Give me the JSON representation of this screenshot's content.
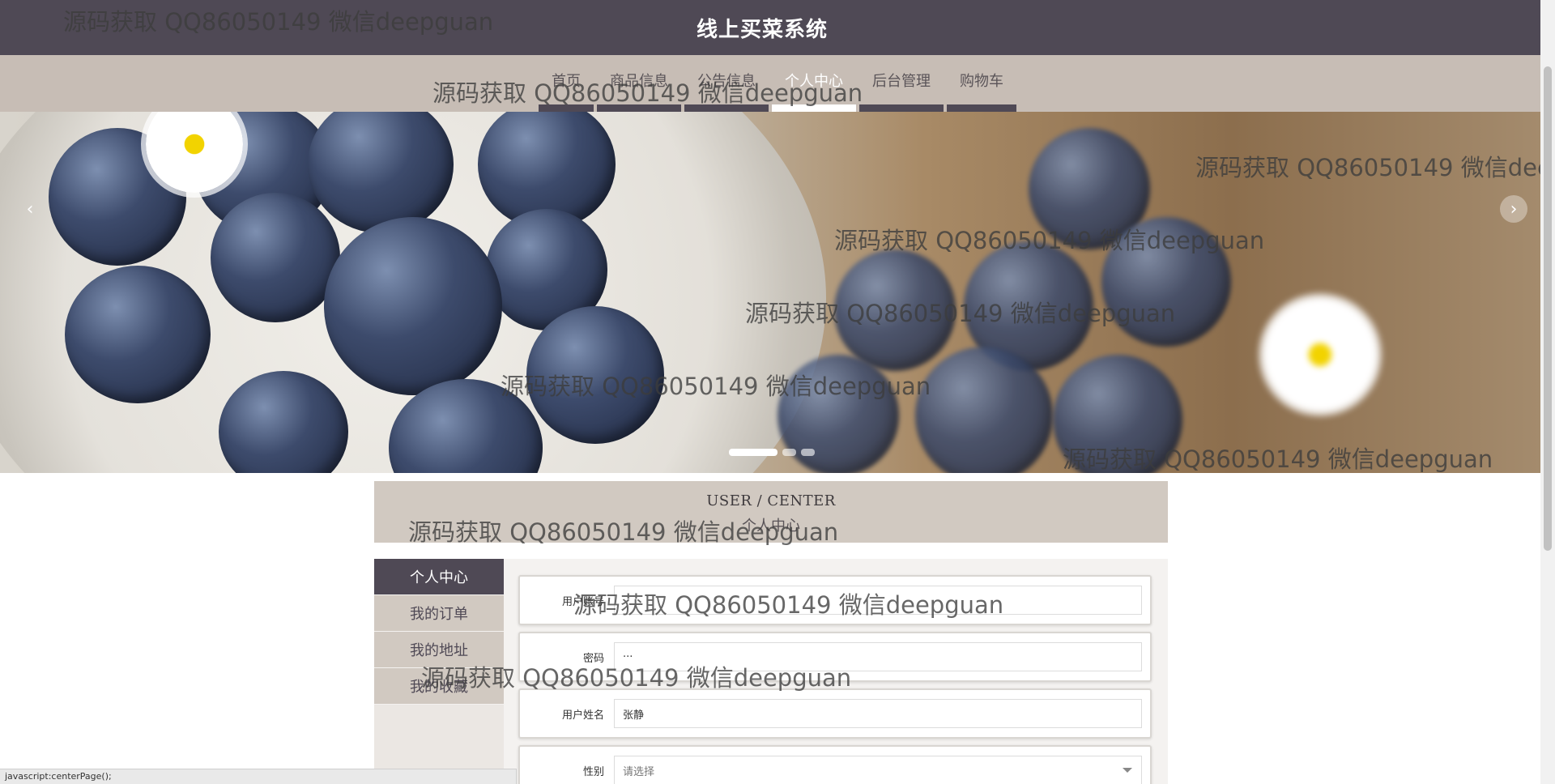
{
  "header": {
    "site_title": "线上买菜系统"
  },
  "nav": {
    "items": [
      {
        "label": "首页"
      },
      {
        "label": "商品信息"
      },
      {
        "label": "公告信息"
      },
      {
        "label": "个人中心"
      },
      {
        "label": "后台管理"
      },
      {
        "label": "购物车"
      }
    ],
    "active_index": 3
  },
  "banner": {
    "prev_glyph": "‹",
    "next_glyph": "›",
    "slide_count": 3,
    "active_slide": 0
  },
  "user_center": {
    "title_en": "USER / CENTER",
    "title_cn": "个人中心"
  },
  "sidebar": {
    "items": [
      {
        "label": "个人中心"
      },
      {
        "label": "我的订单"
      },
      {
        "label": "我的地址"
      },
      {
        "label": "我的收藏"
      }
    ],
    "active_index": 0
  },
  "form": {
    "username": {
      "label": "用户账号",
      "value": ""
    },
    "password": {
      "label": "密码",
      "value": "···"
    },
    "fullname": {
      "label": "用户姓名",
      "value": "张静"
    },
    "gender": {
      "label": "性别",
      "placeholder": "请选择"
    }
  },
  "status_bar": {
    "text": "javascript:centerPage();"
  },
  "watermark": {
    "text": "源码获取 QQ86050149 微信deepguan",
    "text_cut": "源码获取 QQ86050149 微信dee"
  },
  "colors": {
    "header_bg": "#4f4955",
    "nav_bg": "#c7bdb5",
    "accent_light": "#d1c9c1",
    "active_white": "#ffffff"
  }
}
